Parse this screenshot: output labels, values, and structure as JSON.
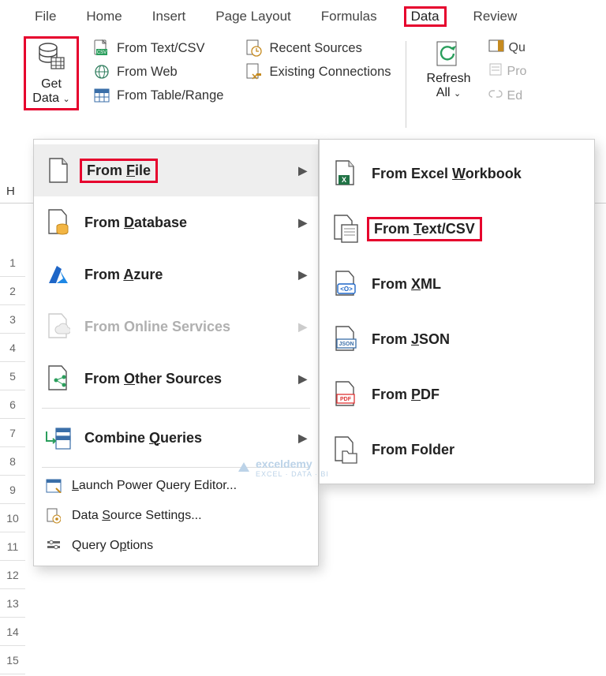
{
  "tabs": {
    "file": "File",
    "home": "Home",
    "insert": "Insert",
    "page_layout": "Page Layout",
    "formulas": "Formulas",
    "data": "Data",
    "review": "Review"
  },
  "ribbon": {
    "get_data": "Get\nData",
    "from_text_csv": "From Text/CSV",
    "from_web": "From Web",
    "from_table_range": "From Table/Range",
    "recent_sources": "Recent Sources",
    "existing_connections": "Existing Connections",
    "refresh_all": "Refresh\nAll",
    "queries": "Qu",
    "properties": "Pro",
    "edit_links": "Ed"
  },
  "menu": {
    "from_file": "From File",
    "from_database": "From Database",
    "from_azure": "From Azure",
    "from_online_services": "From Online Services",
    "from_other_sources": "From Other Sources",
    "combine_queries": "Combine Queries",
    "launch_pq": "Launch Power Query Editor...",
    "data_source_settings": "Data Source Settings...",
    "query_options": "Query Options"
  },
  "submenu": {
    "from_excel_workbook": "From Excel Workbook",
    "from_text_csv": "From Text/CSV",
    "from_xml": "From XML",
    "from_json": "From JSON",
    "from_pdf": "From PDF",
    "from_folder": "From Folder"
  },
  "grid": {
    "col_h": "H",
    "rows": [
      "1",
      "2",
      "3",
      "4",
      "5",
      "6",
      "7",
      "8",
      "9",
      "10",
      "11",
      "12",
      "13",
      "14",
      "15"
    ]
  },
  "watermark": {
    "brand": "exceldemy",
    "tag": "EXCEL · DATA · BI"
  }
}
